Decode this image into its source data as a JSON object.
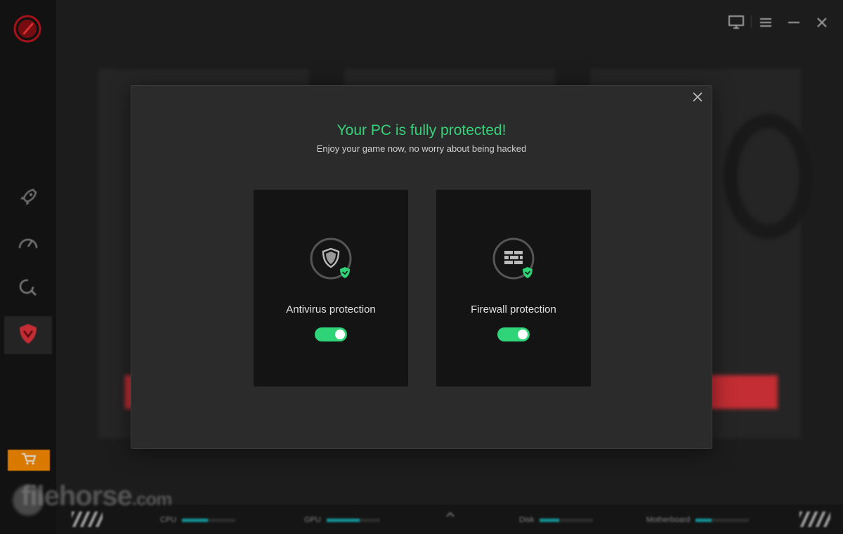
{
  "colors": {
    "accent_green": "#36d27a",
    "toggle_on": "#2ed477",
    "brand_red": "#e5353d",
    "shop_orange": "#ff8f00",
    "bar_teal": "#18a9ac"
  },
  "sidebar": {
    "items": [
      {
        "icon": "rocket-icon",
        "active": false
      },
      {
        "icon": "speedometer-icon",
        "active": false
      },
      {
        "icon": "search-icon",
        "active": false
      },
      {
        "icon": "shield-icon",
        "active": true
      }
    ],
    "shop_icon": "cart-icon"
  },
  "watermark": {
    "text": "filehorse",
    "suffix": ".com"
  },
  "modal": {
    "title": "Your PC is fully protected!",
    "subtitle": "Enjoy your game now, no worry about being hacked",
    "cards": [
      {
        "label": "Antivirus protection",
        "icon": "shield-check-icon",
        "enabled": true
      },
      {
        "label": "Firewall protection",
        "icon": "firewall-check-icon",
        "enabled": true
      }
    ]
  },
  "statusbar": {
    "stats": [
      {
        "label": "CPU",
        "percent": 48
      },
      {
        "label": "GPU",
        "percent": 62
      },
      {
        "label": "Disk",
        "percent": 36
      },
      {
        "label": "Motherboard",
        "percent": 30
      }
    ]
  }
}
